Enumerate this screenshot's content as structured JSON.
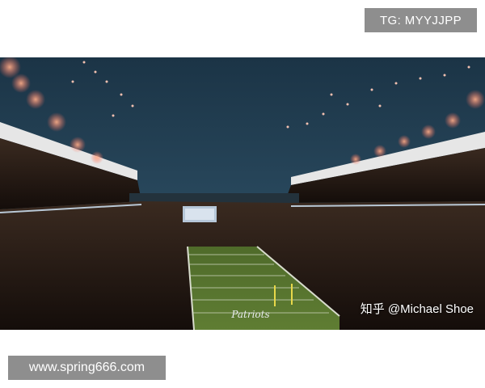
{
  "overlays": {
    "tg_label": "TG: MYYJJPP",
    "watermark": "知乎 @Michael Shoe",
    "site_url": "www.spring666.com"
  },
  "photo": {
    "subject": "stadium-with-fireworks",
    "end_zone_text": "Patriots",
    "colors": {
      "sky_top": "#1f3b4f",
      "sky_bottom": "#2b4a60",
      "field": "#55742e",
      "crowd": "#2a1e17",
      "firework": "#ff6a5a"
    }
  }
}
